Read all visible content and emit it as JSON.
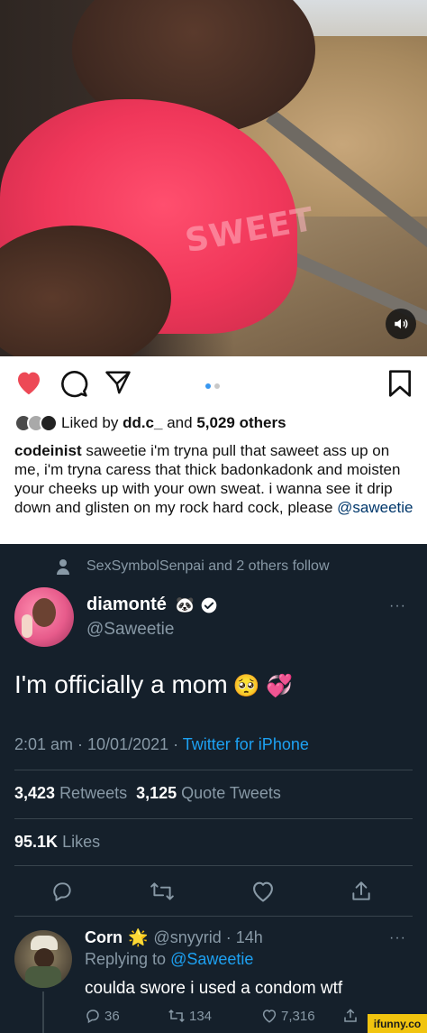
{
  "media": {
    "garment_text": "SWEET",
    "sound_icon": "speaker-icon"
  },
  "instagram": {
    "actions": {
      "like_icon": "heart-icon",
      "comment_icon": "comment-icon",
      "share_icon": "send-icon",
      "save_icon": "bookmark-icon"
    },
    "liked_by_prefix": "Liked by",
    "liked_by_user": "dd.c_",
    "liked_by_and": "and",
    "liked_by_count": "5,029 others",
    "caption_user": "codeinist",
    "caption_text": " saweetie i'm tryna pull that saweet ass up on me, i'm tryna caress that thick badonkadonk and moisten your cheeks up with your own sweat. i wanna see it drip down and glisten on my rock hard cock, please ",
    "caption_mention": "@saweetie",
    "colors": {
      "heart": "#ed4956",
      "dot_active": "#3897f0"
    }
  },
  "twitter": {
    "follow_text": "SexSymbolSenpai and 2 others follow",
    "name": "diamonté",
    "name_emoji": "🐼",
    "handle": "@Saweetie",
    "more": "···",
    "tweet_text": "I'm officially a mom",
    "tweet_emoji": "🥺 💞",
    "time": "2:01 am · 10/01/2021 · ",
    "client": "Twitter for iPhone",
    "retweets_count": "3,423",
    "retweets_label": "Retweets",
    "quotes_count": "3,125",
    "quotes_label": "Quote Tweets",
    "likes_count": "95.1K",
    "likes_label": "Likes",
    "reply": {
      "name": "Corn",
      "name_emoji": "🌟",
      "handle_time": "@snyyrid · 14h",
      "more": "···",
      "replying_prefix": "Replying to ",
      "replying_mention": "@Saweetie",
      "text": "coulda swore i used a condom wtf",
      "replies": "36",
      "retweets": "134",
      "likes": "7,316"
    },
    "colors": {
      "bg": "#15202b",
      "link": "#1da1f2",
      "muted": "#8899a6",
      "divider": "#38444d"
    }
  },
  "watermark": "ifunny.co"
}
